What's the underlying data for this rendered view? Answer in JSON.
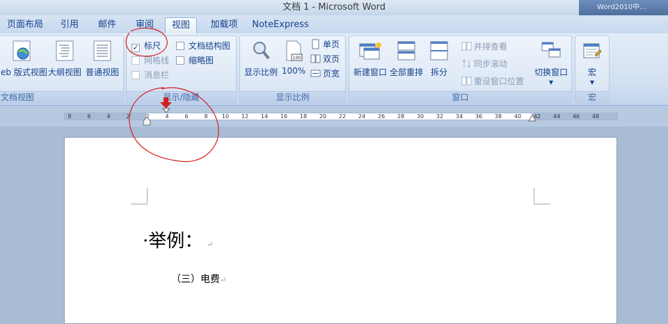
{
  "window": {
    "title": "文档 1 - Microsoft Word",
    "taskbar_item": "Word2010中..."
  },
  "tabs": [
    "页面布局",
    "引用",
    "邮件",
    "审阅",
    "视图",
    "加载项",
    "NoteExpress"
  ],
  "active_tab": "视图",
  "ribbon": {
    "doc_views": {
      "label": "文档视图",
      "buttons": [
        "eb 版式视图",
        "大纲视图",
        "普通视图"
      ]
    },
    "show_hide": {
      "label": "显示/隐藏",
      "ruler": "标尺",
      "gridlines": "网格线",
      "message_bar": "消息栏",
      "doc_map": "文档结构图",
      "thumbnails": "缩略图",
      "ruler_checked": true
    },
    "zoom": {
      "label": "显示比例",
      "zoom_button": "显示比例",
      "percent_button": "100%",
      "one_page": "单页",
      "two_pages": "双页",
      "page_width": "页宽"
    },
    "window_group": {
      "label": "窗口",
      "new_window": "新建窗口",
      "arrange_all": "全部重排",
      "split": "拆分",
      "side_by_side": "并排查看",
      "sync_scroll": "同步滚动",
      "reset_position": "重设窗口位置",
      "switch_windows": "切换窗口"
    },
    "macros": {
      "label": "宏",
      "button": "宏"
    }
  },
  "ruler_ticks": [
    "8",
    "6",
    "4",
    "2",
    "2",
    "4",
    "6",
    "8",
    "10",
    "12",
    "14",
    "16",
    "18",
    "20",
    "22",
    "24",
    "26",
    "28",
    "30",
    "32",
    "34",
    "36",
    "38",
    "40",
    "42",
    "44",
    "46",
    "48"
  ],
  "document": {
    "heading": "·举例：",
    "line1": "（三）电费",
    "para_mark": "↵"
  },
  "colors": {
    "annotation": "#d42020",
    "accent": "#15428b"
  }
}
